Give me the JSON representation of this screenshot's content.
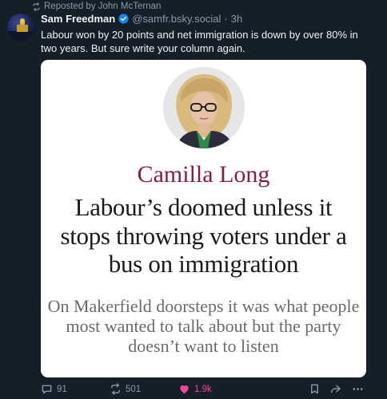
{
  "repost": {
    "text": "Reposted by John McTernan"
  },
  "post": {
    "display_name": "Sam Freedman",
    "handle": "@samfr.bsky.social",
    "separator": "·",
    "time": "3h",
    "text": "Labour won by 20 points and net immigration is down by over 80% in two years. But sure write your column again."
  },
  "card": {
    "byline": "Camilla Long",
    "headline": "Labour’s doomed unless it stops throwing voters under a bus on immigration",
    "standfirst": "On Makerfield doorsteps it was what people most wanted to talk about but the party doesn’t want to listen"
  },
  "actions": {
    "replies": "91",
    "reposts": "501",
    "likes": "1.9k"
  },
  "colors": {
    "background": "#161e27",
    "muted": "#8d9aa9",
    "verified": "#1185fe",
    "like": "#ec4899",
    "byline": "#8a1d3e"
  },
  "icons": [
    "repost-icon",
    "verified-icon",
    "reply-icon",
    "like-icon",
    "bookmark-icon",
    "share-icon",
    "more-icon"
  ]
}
